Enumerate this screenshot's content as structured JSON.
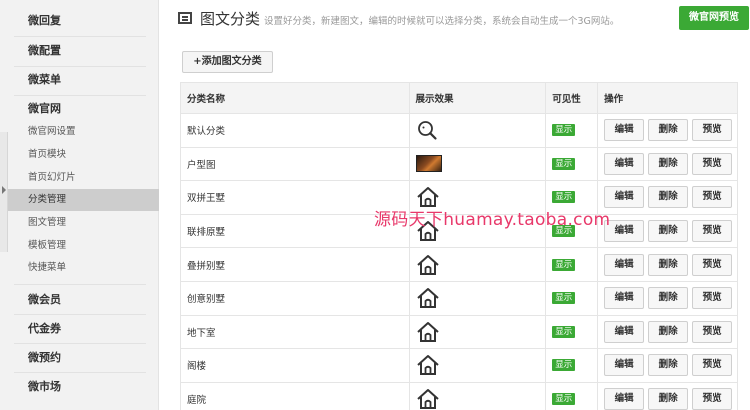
{
  "sidebar": {
    "groups": [
      {
        "label": "微回复"
      },
      {
        "label": "微配置"
      },
      {
        "label": "微菜单"
      },
      {
        "label": "微官网"
      },
      {
        "label": "微会员"
      },
      {
        "label": "代金券"
      },
      {
        "label": "微预约"
      },
      {
        "label": "微市场"
      }
    ],
    "subitems": [
      {
        "label": "微官网设置"
      },
      {
        "label": "首页模块"
      },
      {
        "label": "首页幻灯片"
      },
      {
        "label": "分类管理"
      },
      {
        "label": "图文管理"
      },
      {
        "label": "模板管理"
      },
      {
        "label": "快捷菜单"
      }
    ]
  },
  "header": {
    "title": "图文分类",
    "description": "设置好分类，新建图文，编辑的时候就可以选择分类，系统会自动生成一个3G网站。",
    "preview_button": "微官网预览"
  },
  "toolbar": {
    "add_button": "+添加图文分类"
  },
  "table": {
    "headers": [
      "分类名称",
      "展示效果",
      "可见性",
      "操作"
    ],
    "rows": [
      {
        "name": "默认分类",
        "icon": "search-icon",
        "visibility": "显示"
      },
      {
        "name": "户型图",
        "icon": "thumbnail-image",
        "visibility": "显示"
      },
      {
        "name": "双拼王墅",
        "icon": "home-icon",
        "visibility": "显示"
      },
      {
        "name": "联排原墅",
        "icon": "home-icon",
        "visibility": "显示"
      },
      {
        "name": "叠拼别墅",
        "icon": "home-icon",
        "visibility": "显示"
      },
      {
        "name": "创意别墅",
        "icon": "home-icon",
        "visibility": "显示"
      },
      {
        "name": "地下室",
        "icon": "home-icon",
        "visibility": "显示"
      },
      {
        "name": "阁楼",
        "icon": "home-icon",
        "visibility": "显示"
      },
      {
        "name": "庭院",
        "icon": "home-icon",
        "visibility": "显示"
      }
    ],
    "actions": {
      "edit": "编辑",
      "delete": "删除",
      "preview": "预览"
    }
  },
  "watermark": "源码天下huamay.taoba.com",
  "colors": {
    "accent_green": "#3ba935",
    "watermark": "#e8386a",
    "sidebar_bg": "#f2f2f2"
  }
}
